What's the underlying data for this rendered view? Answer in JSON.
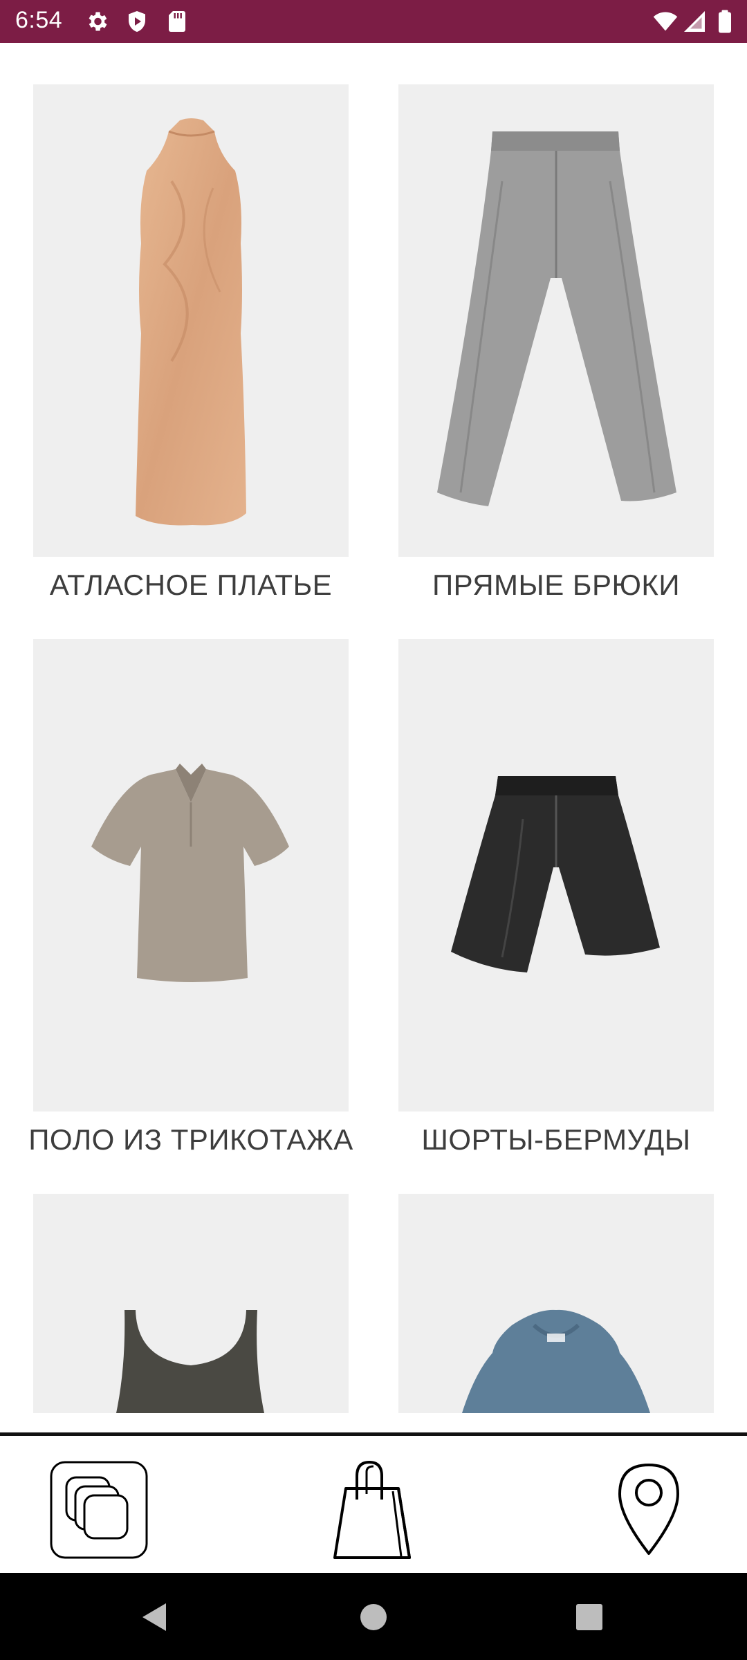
{
  "status_bar": {
    "time": "6:54",
    "background": "#7c1d45",
    "left_icons": [
      "gear-icon",
      "shield-play-icon",
      "sd-card-icon"
    ],
    "right_icons": [
      "wifi-icon",
      "cell-signal-icon",
      "battery-icon"
    ]
  },
  "products": [
    {
      "title": "АТЛАСНОЕ ПЛАТЬЕ",
      "image": "dress-image"
    },
    {
      "title": "ПРЯМЫЕ БРЮКИ",
      "image": "trousers-image"
    },
    {
      "title": "ПОЛО ИЗ ТРИКОТАЖА",
      "image": "polo-image"
    },
    {
      "title": "ШОРТЫ-БЕРМУДЫ",
      "image": "shorts-image"
    },
    {
      "title": "",
      "image": "tank-top-image"
    },
    {
      "title": "",
      "image": "hoodie-image"
    }
  ],
  "bottom_nav": {
    "items": [
      "catalog-icon",
      "shopping-bag-icon",
      "location-pin-icon"
    ]
  },
  "system_nav": {
    "items": [
      "back-icon",
      "home-icon",
      "recents-icon"
    ]
  }
}
